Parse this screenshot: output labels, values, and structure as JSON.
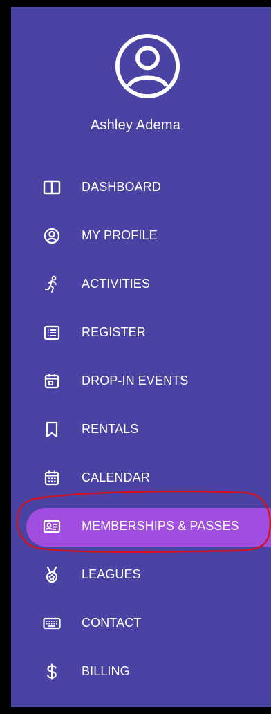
{
  "user": {
    "name": "Ashley Adema",
    "avatar_icon": "user-circle-icon"
  },
  "nav": {
    "items": [
      {
        "label": "DASHBOARD",
        "icon": "dashboard-icon"
      },
      {
        "label": "MY PROFILE",
        "icon": "profile-icon"
      },
      {
        "label": "ACTIVITIES",
        "icon": "running-person-icon"
      },
      {
        "label": "REGISTER",
        "icon": "list-icon"
      },
      {
        "label": "DROP-IN EVENTS",
        "icon": "calendar-day-icon"
      },
      {
        "label": "RENTALS",
        "icon": "bookmark-icon"
      },
      {
        "label": "CALENDAR",
        "icon": "calendar-icon"
      },
      {
        "label": "MEMBERSHIPS & PASSES",
        "icon": "id-card-icon",
        "active": true
      },
      {
        "label": "LEAGUES",
        "icon": "medal-icon"
      },
      {
        "label": "CONTACT",
        "icon": "keyboard-icon"
      },
      {
        "label": "BILLING",
        "icon": "dollar-icon"
      }
    ]
  },
  "colors": {
    "sidebar_bg": "#4b43a4",
    "active_pill": "#a14de0",
    "text": "#ffffff",
    "annotation": "#d0121b"
  }
}
